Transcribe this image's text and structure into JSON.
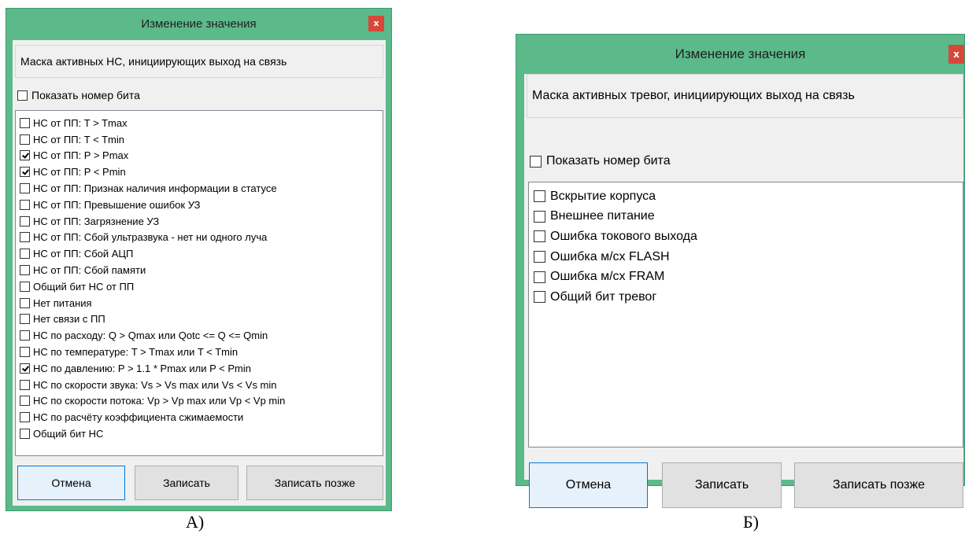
{
  "dialog_a": {
    "title": "Изменение значения",
    "close_label": "x",
    "description": "Маска активных НС, инициирующих выход на связь",
    "show_bit_label": "Показать номер бита",
    "show_bit_checked": false,
    "items": [
      {
        "label": "НС от ПП: T > Tmax",
        "checked": false
      },
      {
        "label": "НС от ПП: T < Tmin",
        "checked": false
      },
      {
        "label": "НС от ПП: P > Pmax",
        "checked": true
      },
      {
        "label": "НС от ПП: P < Pmin",
        "checked": true
      },
      {
        "label": "НС от ПП: Признак наличия информации в статусе",
        "checked": false
      },
      {
        "label": "НС от ПП: Превышение ошибок УЗ",
        "checked": false
      },
      {
        "label": "НС от ПП: Загрязнение УЗ",
        "checked": false
      },
      {
        "label": "НС от ПП: Сбой ультразвука - нет ни одного луча",
        "checked": false
      },
      {
        "label": "НС от ПП: Сбой АЦП",
        "checked": false
      },
      {
        "label": "НС от ПП: Сбой памяти",
        "checked": false
      },
      {
        "label": "Общий бит НС от ПП",
        "checked": false
      },
      {
        "label": "Нет питания",
        "checked": false
      },
      {
        "label": "Нет связи с ПП",
        "checked": false
      },
      {
        "label": "НС по расходу: Q > Qmax или Qotc <= Q <= Qmin",
        "checked": false
      },
      {
        "label": "НС по температуре: T > Tmax или T < Tmin",
        "checked": false
      },
      {
        "label": "НС по давлению: P > 1.1 * Pmax или P < Pmin",
        "checked": true
      },
      {
        "label": "НС по скорости звука: Vs > Vs max или Vs < Vs min",
        "checked": false
      },
      {
        "label": "НС по скорости потока: Vp > Vp max или Vp < Vp min",
        "checked": false
      },
      {
        "label": "НС по расчёту коэффициента сжимаемости",
        "checked": false
      },
      {
        "label": "Общий бит НС",
        "checked": false
      }
    ],
    "buttons": {
      "cancel": "Отмена",
      "write": "Записать",
      "write_later": "Записать позже"
    },
    "caption": "А)"
  },
  "dialog_b": {
    "title": "Изменение значения",
    "close_label": "x",
    "description": "Маска активных тревог, инициирующих выход на связь",
    "show_bit_label": "Показать номер бита",
    "show_bit_checked": false,
    "items": [
      {
        "label": "Вскрытие корпуса",
        "checked": false
      },
      {
        "label": "Внешнее питание",
        "checked": false
      },
      {
        "label": "Ошибка токового выхода",
        "checked": false
      },
      {
        "label": "Ошибка м/сх FLASH",
        "checked": false
      },
      {
        "label": "Ошибка м/сх FRAM",
        "checked": false
      },
      {
        "label": "Общий бит тревог",
        "checked": false
      }
    ],
    "buttons": {
      "cancel": "Отмена",
      "write": "Записать",
      "write_later": "Записать позже"
    },
    "caption": "Б)"
  },
  "colors": {
    "window_frame": "#5bb98a",
    "close_button": "#d9473a",
    "client_bg": "#f0f0f0",
    "focus_border": "#0078d7"
  }
}
